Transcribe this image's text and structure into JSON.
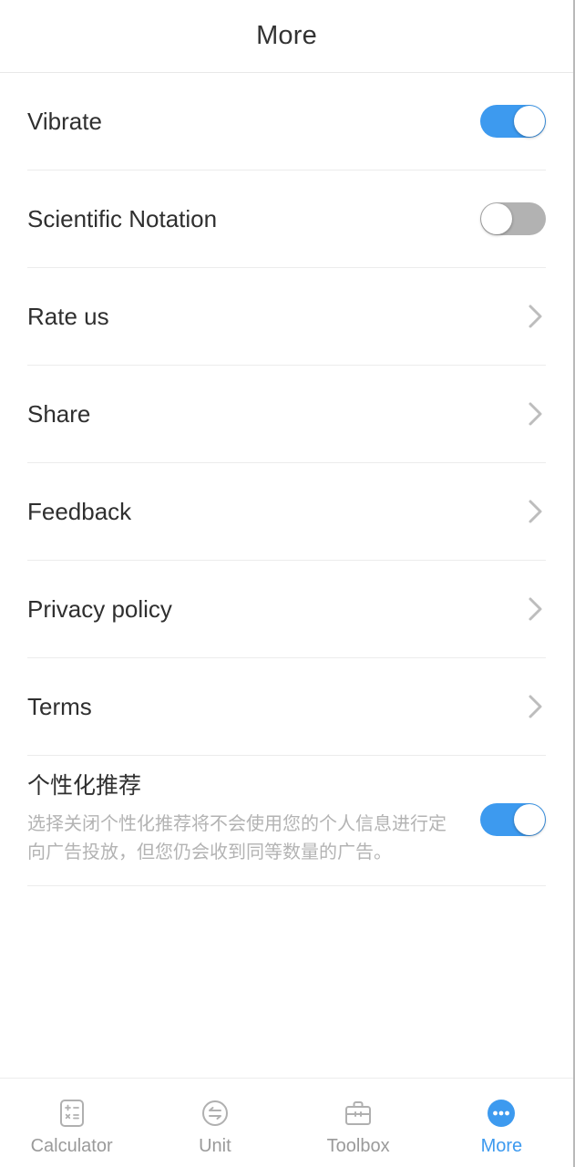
{
  "header": {
    "title": "More"
  },
  "settings": {
    "rows": [
      {
        "label": "Vibrate",
        "type": "toggle",
        "state": "on",
        "icon": "toggle-switch"
      },
      {
        "label": "Scientific Notation",
        "type": "toggle",
        "state": "off",
        "icon": "toggle-switch"
      },
      {
        "label": "Rate us",
        "type": "link",
        "icon": "chevron-right-icon"
      },
      {
        "label": "Share",
        "type": "link",
        "icon": "chevron-right-icon"
      },
      {
        "label": "Feedback",
        "type": "link",
        "icon": "chevron-right-icon"
      },
      {
        "label": "Privacy policy",
        "type": "link",
        "icon": "chevron-right-icon"
      },
      {
        "label": "Terms",
        "type": "link",
        "icon": "chevron-right-icon"
      }
    ],
    "personalized": {
      "title": "个性化推荐",
      "description": "选择关闭个性化推荐将不会使用您的个人信息进行定向广告投放，但您仍会收到同等数量的广告。",
      "state": "on"
    }
  },
  "tabbar": {
    "items": [
      {
        "label": "Calculator",
        "icon": "calculator-icon",
        "active": false
      },
      {
        "label": "Unit",
        "icon": "unit-convert-icon",
        "active": false
      },
      {
        "label": "Toolbox",
        "icon": "briefcase-icon",
        "active": false
      },
      {
        "label": "More",
        "icon": "more-dots-icon",
        "active": true
      }
    ]
  },
  "colors": {
    "accent": "#3d9aef",
    "toggle_off": "#b2b2b2",
    "text_primary": "#2f2f2f",
    "text_muted": "#b3b3b3",
    "divider": "#ececec"
  }
}
